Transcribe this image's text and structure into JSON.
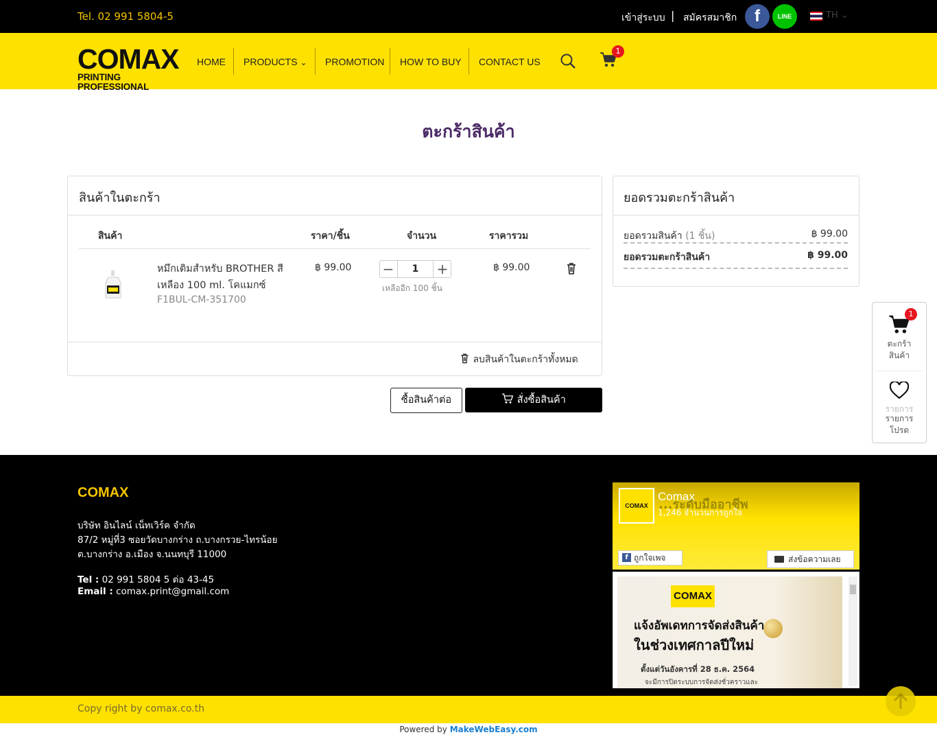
{
  "topbar": {
    "tel": "Tel. 02 991 5804-5",
    "login": "เข้าสู่ระบบ",
    "separator": "|",
    "register": "สมัครสมาชิก",
    "facebook_glyph": "f",
    "line_glyph": "LINE",
    "language": "TH"
  },
  "nav": {
    "logo_main": "COMAX",
    "logo_sub": "PRINTING PROFESSIONAL",
    "home": "HOME",
    "products": "PRODUCTS",
    "promotion": "PROMOTION",
    "how_to_buy": "HOW TO BUY",
    "contact": "CONTACT US",
    "cart_count": "1"
  },
  "page": {
    "title": "ตะกร้าสินค้า"
  },
  "cart": {
    "title": "สินค้าในตะกร้า",
    "headers": {
      "product": "สินค้า",
      "unit_price": "ราคา/ชิ้น",
      "quantity": "จำนวน",
      "total": "ราคารวม"
    },
    "items": [
      {
        "name": "หมึกเติมสำหรับ BROTHER สีเหลือง 100 ml. โคแมกซ์",
        "sku": "F1BUL-CM-351700",
        "price": "฿ 99.00",
        "qty": "1",
        "remaining": "เหลืออีก 100 ชิ้น",
        "total": "฿ 99.00"
      }
    ],
    "clear_all": "ลบสินค้าในตะกร้าทั้งหมด",
    "continue_shopping": "ซื้อสินค้าต่อ",
    "checkout": "สั่งซื้อสินค้า"
  },
  "summary": {
    "title": "ยอดรวมตะกร้าสินค้า",
    "subtotal_label": "ยอดรวมสินค้า",
    "subtotal_count": "(1 ชิ้น)",
    "subtotal_value": "฿ 99.00",
    "grand_label": "ยอดรวมตะกร้าสินค้า",
    "grand_value": "฿ 99.00"
  },
  "floating": {
    "cart_label_1": "ตะกร้า",
    "cart_label_2": "สินค้า",
    "cart_count": "1",
    "wish_label_1": "รายการ",
    "wish_label_2": "รายการ",
    "wish_label_3": "โปรด"
  },
  "footer": {
    "brand": "COMAX",
    "company": "บริษัท อินไลน์ เน็ทเวิร์ค จำกัด",
    "address1": "87/2 หมู่ที่3 ซอยวัดบางกร่าง ถ.บางกรวย-ไทรน้อย",
    "address2": "ต.บางกร่าง อ.เมือง จ.นนทบุรี 11000",
    "tel_label": "Tel :",
    "tel": "02 991 5804 5 ต่อ 43-45",
    "email_label": "Email :",
    "email": "comax.print@gmail.com",
    "fb": {
      "page_name": "Comax",
      "likes": "1,246 จำนวนการถูกใจ",
      "headline": "...ระดับมืออาชีพ",
      "like_button": "ถูกใจเพจ",
      "message_button": "ส่งข้อความเลย",
      "post_logo": "COMAX",
      "post_line1": "แจ้งอัพเดทการจัดส่งสินค้า",
      "post_line2": "ในช่วงเทศกาลปีใหม่",
      "post_line3": "ตั้งแต่วันอังคารที่ 28 ธ.ค. 2564",
      "post_line4": "จะมีการปิดระบบการจัดส่งชั่วคราวและ"
    },
    "copyright": "Copy right by comax.co.th",
    "powered_by": "Powered by",
    "powered_brand": "MakeWebEasy.com"
  },
  "colors": {
    "brand_yellow": "#ffe100",
    "title_purple": "#4b2a66",
    "badge_red": "#e5161f"
  }
}
